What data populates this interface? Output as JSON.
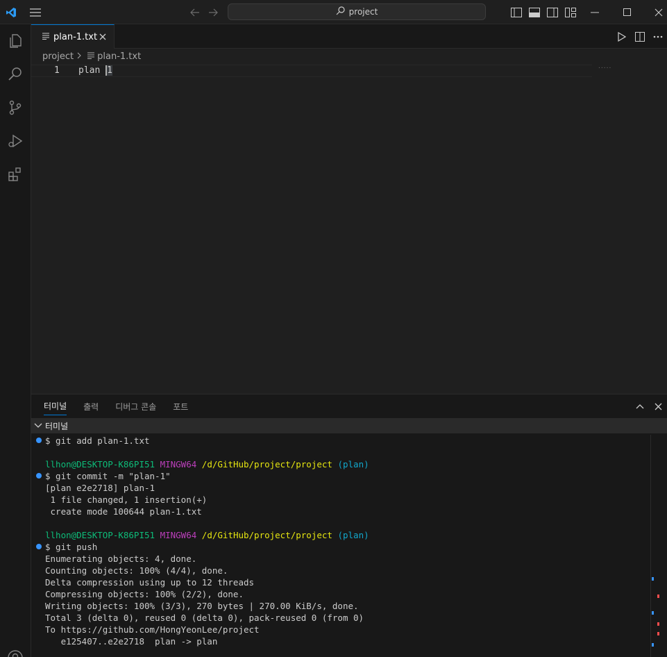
{
  "titlebar": {
    "search_label": "project",
    "icons": [
      "vscode-logo-icon",
      "menu-icon",
      "back-arrow-icon",
      "forward-arrow-icon",
      "search-icon",
      "toggle-sidebar-icon",
      "toggle-panel-icon",
      "toggle-secondary-sidebar-icon",
      "customize-layout-icon",
      "minimize-icon",
      "maximize-icon",
      "close-icon"
    ]
  },
  "activity_bar": {
    "items": [
      "explorer-icon",
      "search-icon",
      "source-control-icon",
      "run-debug-icon",
      "extensions-icon",
      "account-icon"
    ]
  },
  "tabs": [
    {
      "label": "plan-1.txt",
      "active": true
    }
  ],
  "breadcrumb": {
    "folder": "project",
    "file": "plan-1.txt"
  },
  "editor": {
    "line_number": "1",
    "text_before_cursor": "plan ",
    "cursor_char": "1",
    "minimap": "....."
  },
  "panel": {
    "tabs": [
      {
        "label": "터미널",
        "active": true
      },
      {
        "label": "출력",
        "active": false
      },
      {
        "label": "디버그 콘솔",
        "active": false
      },
      {
        "label": "포트",
        "active": false
      }
    ],
    "terminal_header": "터미널"
  },
  "terminal": {
    "cmd1": "$ git add plan-1.txt",
    "prompt_user": "llhon@DESKTOP-K86PI51",
    "prompt_env": "MINGW64",
    "prompt_path": "/d/GitHub/project/project",
    "prompt_branch": "(plan)",
    "cmd2": "$ git commit -m \"plan-1\"",
    "out2_1": "[plan e2e2718] plan-1",
    "out2_2": " 1 file changed, 1 insertion(+)",
    "out2_3": " create mode 100644 plan-1.txt",
    "cmd3": "$ git push",
    "out3_1": "Enumerating objects: 4, done.",
    "out3_2": "Counting objects: 100% (4/4), done.",
    "out3_3": "Delta compression using up to 12 threads",
    "out3_4": "Compressing objects: 100% (2/2), done.",
    "out3_5": "Writing objects: 100% (3/3), 270 bytes | 270.00 KiB/s, done.",
    "out3_6": "Total 3 (delta 0), reused 0 (delta 0), pack-reused 0 (from 0)",
    "out3_7": "To https://github.com/HongYeonLee/project",
    "out3_8": "   e125407..e2e2718  plan -> plan"
  },
  "colors": {
    "accent": "#0078d4",
    "dot": "#3794ff",
    "user": "#0dbc79",
    "env": "#bc3fbc",
    "path": "#e5e510",
    "branch": "#11a8cd"
  }
}
